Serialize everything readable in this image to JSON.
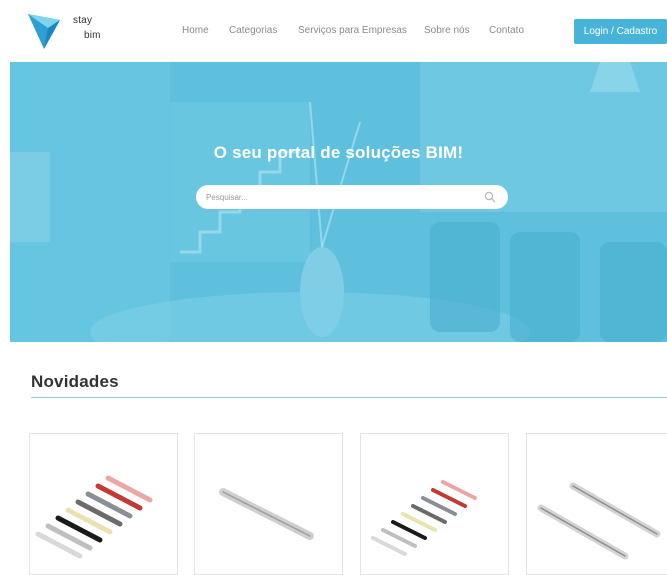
{
  "header": {
    "logo": {
      "line1": "stay",
      "line2": "bim"
    },
    "nav": [
      {
        "label": "Home"
      },
      {
        "label": "Categorias"
      },
      {
        "label": "Serviços para Empresas"
      },
      {
        "label": "Sobre nós"
      },
      {
        "label": "Contato"
      }
    ],
    "login_label": "Login / Cadastro"
  },
  "hero": {
    "title": "O seu portal de soluções BIM!",
    "search": {
      "placeholder": "Pesquisar...",
      "value": ""
    }
  },
  "section": {
    "title": "Novidades"
  },
  "products": [
    {
      "icon": "multi-color-profiles-icon"
    },
    {
      "icon": "single-profile-icon"
    },
    {
      "icon": "multi-color-profiles-icon"
    },
    {
      "icon": "double-profile-icon"
    }
  ],
  "colors": {
    "accent": "#48b3d8",
    "hero": "#62c2de",
    "divider": "#8ec9e6"
  }
}
